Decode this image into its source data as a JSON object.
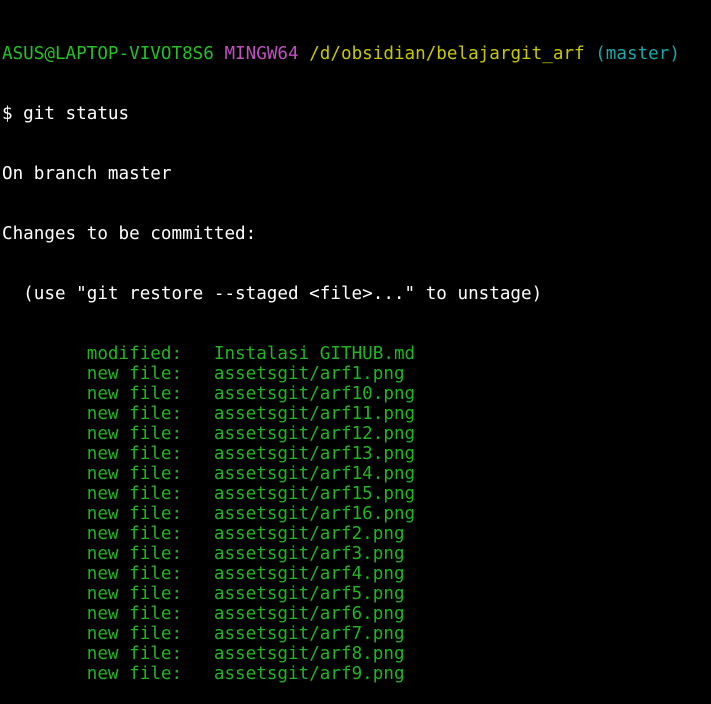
{
  "prompt": {
    "user_host": "ASUS@LAPTOP-VIVOT8S6",
    "shell": "MINGW64",
    "path": "/d/obsidian/belajargit_arf",
    "branch": "(master)"
  },
  "command": "$ git status",
  "output": {
    "branch_line": "On branch master",
    "header": "Changes to be committed:",
    "hint": "  (use \"git restore --staged <file>...\" to unstage)",
    "entries": [
      {
        "status": "modified:",
        "file": "Instalasi GITHUB.md"
      },
      {
        "status": "new file:",
        "file": "assetsgit/arf1.png"
      },
      {
        "status": "new file:",
        "file": "assetsgit/arf10.png"
      },
      {
        "status": "new file:",
        "file": "assetsgit/arf11.png"
      },
      {
        "status": "new file:",
        "file": "assetsgit/arf12.png"
      },
      {
        "status": "new file:",
        "file": "assetsgit/arf13.png"
      },
      {
        "status": "new file:",
        "file": "assetsgit/arf14.png"
      },
      {
        "status": "new file:",
        "file": "assetsgit/arf15.png"
      },
      {
        "status": "new file:",
        "file": "assetsgit/arf16.png"
      },
      {
        "status": "new file:",
        "file": "assetsgit/arf2.png"
      },
      {
        "status": "new file:",
        "file": "assetsgit/arf3.png"
      },
      {
        "status": "new file:",
        "file": "assetsgit/arf4.png"
      },
      {
        "status": "new file:",
        "file": "assetsgit/arf5.png"
      },
      {
        "status": "new file:",
        "file": "assetsgit/arf6.png"
      },
      {
        "status": "new file:",
        "file": "assetsgit/arf7.png"
      },
      {
        "status": "new file:",
        "file": "assetsgit/arf8.png"
      },
      {
        "status": "new file:",
        "file": "assetsgit/arf9.png"
      }
    ]
  },
  "colors": {
    "background": "#000000",
    "user_host": "#24c024",
    "shell": "#c050c0",
    "path": "#c8c800",
    "branch": "#1aa7a7",
    "staged": "#22b422",
    "text": "#ffffff"
  }
}
